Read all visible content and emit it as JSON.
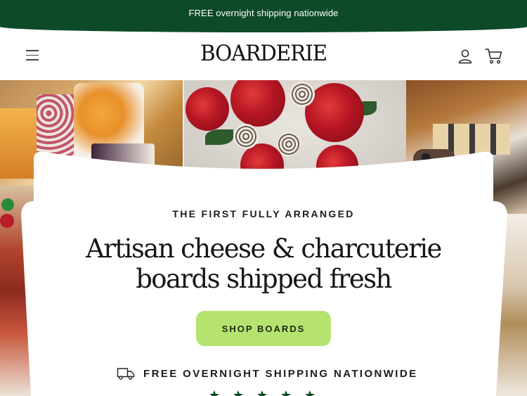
{
  "announcement": {
    "text": "FREE overnight shipping nationwide"
  },
  "header": {
    "logo": "BOARDERIE"
  },
  "hero": {
    "eyebrow": "THE FIRST FULLY ARRANGED",
    "headline_line1": "Artisan cheese & charcuterie",
    "headline_line2": "boards shipped fresh",
    "cta_label": "SHOP BOARDS",
    "shipping_text": "FREE OVERNIGHT SHIPPING NATIONWIDE",
    "rating_stars": 5
  },
  "colors": {
    "brand_green": "#0c4a28",
    "cta_green": "#b6e36f",
    "text_dark": "#161616"
  },
  "icons": [
    "hamburger-menu-icon",
    "account-icon",
    "cart-icon",
    "truck-icon",
    "star-icon"
  ]
}
